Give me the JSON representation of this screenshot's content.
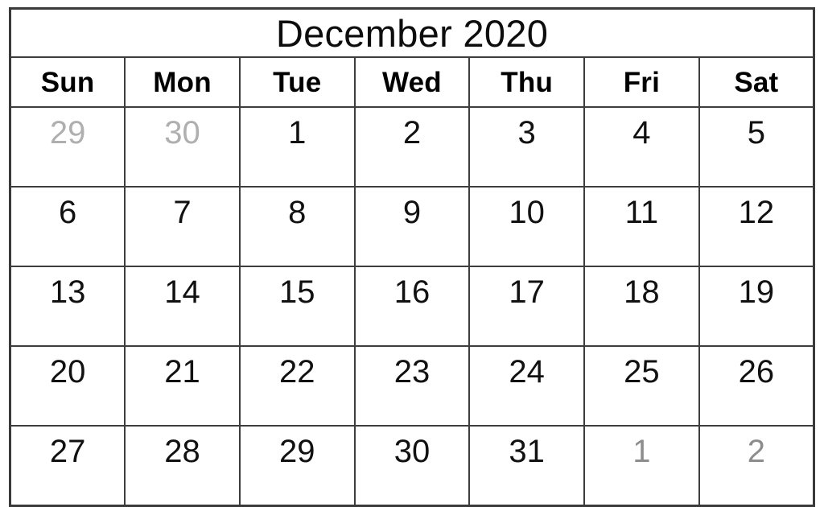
{
  "calendar": {
    "title": "December 2020",
    "month": "December",
    "year": "2020",
    "weekday_headers": [
      {
        "label": "Sun"
      },
      {
        "label": "Mon"
      },
      {
        "label": "Tue"
      },
      {
        "label": "Wed"
      },
      {
        "label": "Thu"
      },
      {
        "label": "Fri"
      },
      {
        "label": "Sat"
      }
    ],
    "colors": {
      "grid_line": "#3d3d3d",
      "outer_border": "#3a3a3a",
      "title_text": "#0d0d0d",
      "header_text": "#000000",
      "day_text": "#111111",
      "leading_muted_text": "#afafaf",
      "trailing_muted_text": "#8d8d8d",
      "background": "#ffffff"
    },
    "weeks": [
      {
        "days": [
          {
            "number": "29",
            "state": "leading"
          },
          {
            "number": "30",
            "state": "leading"
          },
          {
            "number": "1",
            "state": "current"
          },
          {
            "number": "2",
            "state": "current"
          },
          {
            "number": "3",
            "state": "current"
          },
          {
            "number": "4",
            "state": "current"
          },
          {
            "number": "5",
            "state": "current"
          }
        ]
      },
      {
        "days": [
          {
            "number": "6",
            "state": "current"
          },
          {
            "number": "7",
            "state": "current"
          },
          {
            "number": "8",
            "state": "current"
          },
          {
            "number": "9",
            "state": "current"
          },
          {
            "number": "10",
            "state": "current"
          },
          {
            "number": "11",
            "state": "current"
          },
          {
            "number": "12",
            "state": "current"
          }
        ]
      },
      {
        "days": [
          {
            "number": "13",
            "state": "current"
          },
          {
            "number": "14",
            "state": "current"
          },
          {
            "number": "15",
            "state": "current"
          },
          {
            "number": "16",
            "state": "current"
          },
          {
            "number": "17",
            "state": "current"
          },
          {
            "number": "18",
            "state": "current"
          },
          {
            "number": "19",
            "state": "current"
          }
        ]
      },
      {
        "days": [
          {
            "number": "20",
            "state": "current"
          },
          {
            "number": "21",
            "state": "current"
          },
          {
            "number": "22",
            "state": "current"
          },
          {
            "number": "23",
            "state": "current"
          },
          {
            "number": "24",
            "state": "current"
          },
          {
            "number": "25",
            "state": "current"
          },
          {
            "number": "26",
            "state": "current"
          }
        ]
      },
      {
        "days": [
          {
            "number": "27",
            "state": "current"
          },
          {
            "number": "28",
            "state": "current"
          },
          {
            "number": "29",
            "state": "current"
          },
          {
            "number": "30",
            "state": "current"
          },
          {
            "number": "31",
            "state": "current"
          },
          {
            "number": "1",
            "state": "trailing"
          },
          {
            "number": "2",
            "state": "trailing"
          }
        ]
      }
    ]
  }
}
